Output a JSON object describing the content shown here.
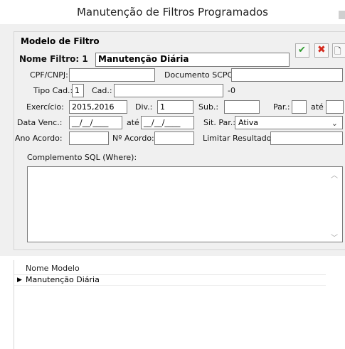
{
  "window": {
    "title": "Manutenção de Filtros Programados"
  },
  "group": {
    "title": "Modelo de Filtro"
  },
  "nome_filtro": {
    "label": "Nome Filtro: 1",
    "value": "Manutenção Diária"
  },
  "toolbar": {
    "confirm_icon": "✔",
    "cancel_icon": "✖",
    "new_icon": "🗋"
  },
  "cpf_cnpj": {
    "label": "CPF/CNPJ:",
    "value": ""
  },
  "documento_scpc": {
    "label": "Documento SCPC:",
    "value": ""
  },
  "tipo_cad": {
    "label": "Tipo Cad.:",
    "value": "1"
  },
  "cad": {
    "label": "Cad.:",
    "value": "",
    "suffix": "-0"
  },
  "exercicio": {
    "label": "Exercício:",
    "value": "2015,2016"
  },
  "div": {
    "label": "Div.:",
    "value": "1"
  },
  "sub": {
    "label": "Sub.:",
    "value": ""
  },
  "par": {
    "label": "Par.:",
    "value": "",
    "ate_label": "até",
    "ate_value": ""
  },
  "data_venc": {
    "label": "Data Venc.:",
    "from": "__/__/____",
    "ate_label": "até",
    "to": "__/__/____"
  },
  "sit_par": {
    "label": "Sit. Par.:",
    "value": "Ativa"
  },
  "ano_acordo": {
    "label": "Ano Acordo:",
    "value": ""
  },
  "num_acordo": {
    "label": "Nº Acordo:",
    "value": ""
  },
  "limitar": {
    "label": "Limitar Resultado:",
    "value": ""
  },
  "complemento": {
    "label": "Complemento SQL (Where):",
    "value": ""
  },
  "list": {
    "column": "Nome Modelo",
    "rows": [
      {
        "pointer": "▶",
        "name": "Manutenção Diária"
      }
    ]
  }
}
